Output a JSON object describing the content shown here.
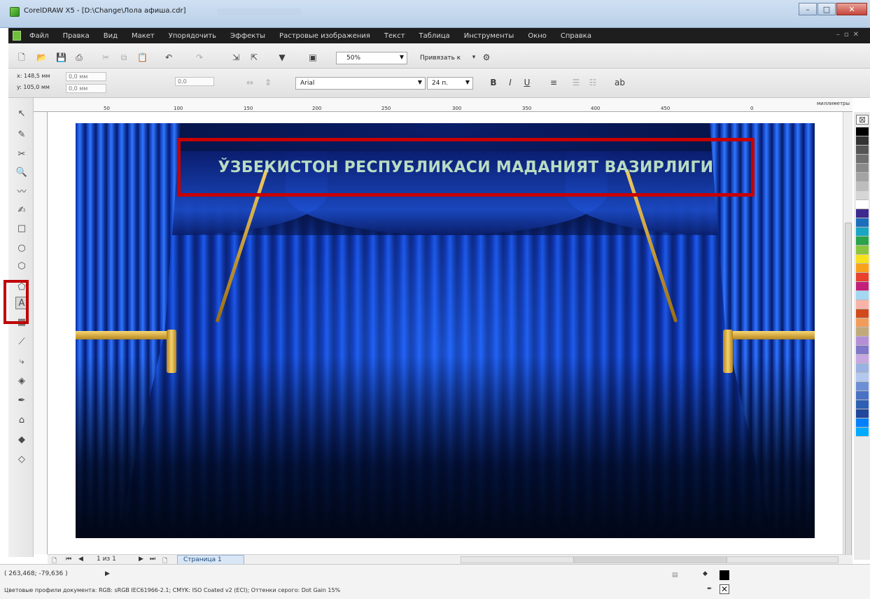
{
  "window": {
    "title": "CorelDRAW X5 - [D:\\Change\\Лола афиша.cdr]"
  },
  "menu": {
    "items": [
      "Файл",
      "Правка",
      "Вид",
      "Макет",
      "Упорядочить",
      "Эффекты",
      "Растровые изображения",
      "Текст",
      "Таблица",
      "Инструменты",
      "Окно",
      "Справка"
    ]
  },
  "toolbar": {
    "zoom": "50%",
    "snap_label": "Привязать к"
  },
  "property_bar": {
    "x": "x: 148,5 мм",
    "y": "y: 105,0 мм",
    "w": "0,0 мм",
    "h": "0,0 мм",
    "angle": "0,0",
    "font": "Arial",
    "font_size": "24 п."
  },
  "ruler": {
    "ticks": [
      "0",
      "50",
      "100",
      "150",
      "200",
      "250",
      "300",
      "350",
      "400",
      "450"
    ],
    "units": "миллиметры"
  },
  "canvas": {
    "stage_title": "ЎЗБЕКИСТОН РЕСПУБЛИКАСИ МАДАНИЯТ ВАЗИРЛИГИ"
  },
  "navigator": {
    "page_count": "1 из 1",
    "page_tab": "Страница 1"
  },
  "status": {
    "coords": "( 263,468; -79,636 )",
    "color_profile": "Цветовые профили документа: RGB: sRGB IEC61966-2.1; CMYK: ISO Coated v2 (ECI); Оттенки серого: Dot Gain 15%"
  },
  "colors": {
    "highlight": "#c80000",
    "stage_text": "#b9dcc2",
    "menubar": "#1e1e1e"
  },
  "palette": [
    "#000000",
    "#333333",
    "#555555",
    "#707070",
    "#8a8a8a",
    "#a3a3a3",
    "#bdbdbd",
    "#d6d6d6",
    "#ffffff",
    "#3e2a8e",
    "#1d6dbd",
    "#1aa6c2",
    "#2ca34a",
    "#8bc53f",
    "#f7e21b",
    "#f9a11b",
    "#e8412c",
    "#c21f7a",
    "#a4d7f2",
    "#f8b2a6",
    "#d04a1c",
    "#f29c5a",
    "#c1a97a",
    "#b48fd6",
    "#7f77c9",
    "#c7a7e0",
    "#99b1e3",
    "#b3c8ef",
    "#6c8fd6",
    "#4a71c4",
    "#2f5fb2",
    "#21479a",
    "#0080ff",
    "#00aaff"
  ]
}
